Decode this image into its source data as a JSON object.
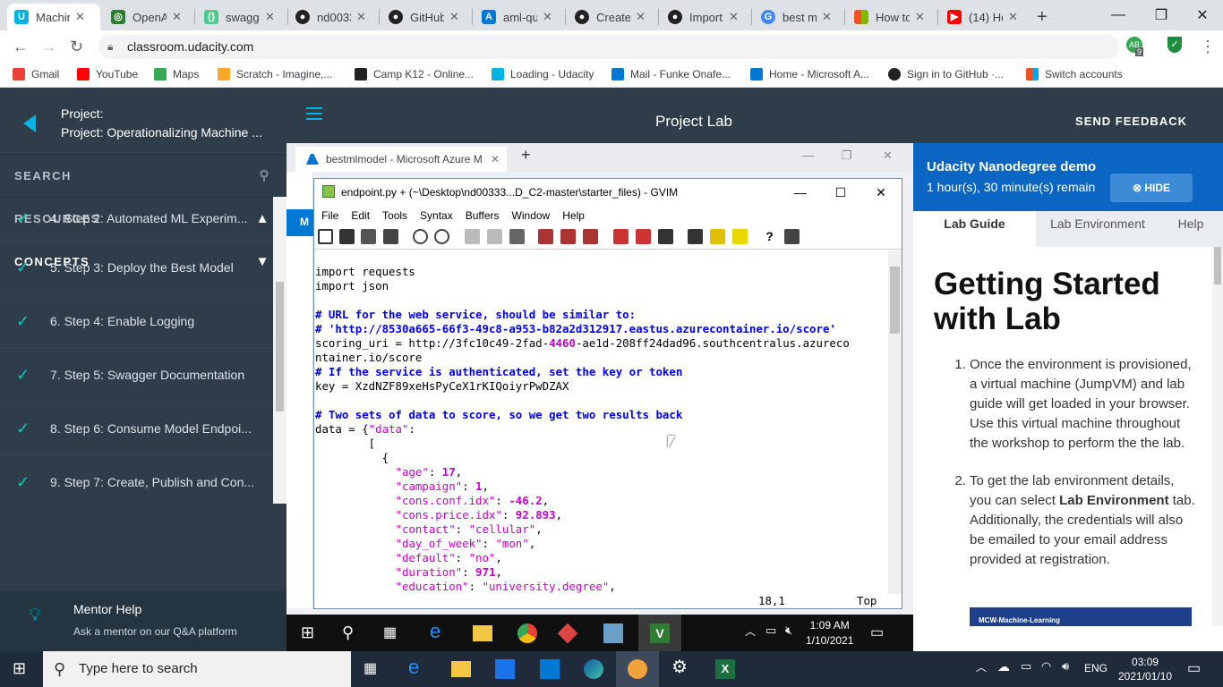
{
  "browser": {
    "tabs": [
      {
        "title": "Machin"
      },
      {
        "title": "OpenA"
      },
      {
        "title": "swagge"
      },
      {
        "title": "nd0033"
      },
      {
        "title": "GitHub"
      },
      {
        "title": "aml-qu"
      },
      {
        "title": "Create"
      },
      {
        "title": "Import"
      },
      {
        "title": "best m"
      },
      {
        "title": "How to"
      },
      {
        "title": "(14) Ho"
      }
    ],
    "url": "classroom.udacity.com",
    "profile_badge": "9",
    "bookmarks": [
      {
        "label": "Gmail",
        "color": "#ea4335"
      },
      {
        "label": "YouTube",
        "color": "#ff0000"
      },
      {
        "label": "Maps",
        "color": "#34a853"
      },
      {
        "label": "Scratch - Imagine,...",
        "color": "#f9a825"
      },
      {
        "label": "Camp K12 - Online...",
        "color": "#222222"
      },
      {
        "label": "Loading - Udacity",
        "color": "#02b3e4"
      },
      {
        "label": "Mail - Funke Onafe...",
        "color": "#0078d4"
      },
      {
        "label": "Home - Microsoft A...",
        "color": "#0078d4"
      },
      {
        "label": "Sign in to GitHub ·...",
        "color": "#222222"
      },
      {
        "label": "Switch accounts",
        "color": "#f25022"
      }
    ]
  },
  "udacity": {
    "project_label": "Project:",
    "project_title": "Project: Operationalizing Machine ...",
    "search_label": "SEARCH",
    "resources_label": "RESOURCES",
    "concepts_label": "CONCEPTS",
    "concepts": [
      "4. Step 2: Automated ML Experim...",
      "5. Step 3: Deploy the Best Model",
      "6. Step 4: Enable Logging",
      "7. Step 5: Swagger Documentation",
      "8. Step 6: Consume Model Endpoi...",
      "9. Step 7: Create, Publish and Con..."
    ],
    "mentor_title": "Mentor Help",
    "mentor_sub": "Ask a mentor on our Q&A platform",
    "header_title": "Project Lab",
    "feedback": "SEND FEEDBACK"
  },
  "vm": {
    "edge_tab": "bestmlmodel - Microsoft Azure M",
    "azure_letter": "M",
    "gvim": {
      "title": "endpoint.py + (~\\Desktop\\nd00333...D_C2-master\\starter_files) - GVIM",
      "menu": [
        "File",
        "Edit",
        "Tools",
        "Syntax",
        "Buffers",
        "Window",
        "Help"
      ],
      "status_pos": "18,1",
      "status_scroll": "Top"
    },
    "clock_time": "1:09 AM",
    "clock_date": "1/10/2021"
  },
  "lab": {
    "heading": "Udacity Nanodegree demo",
    "time_left": "1 hour(s), 30 minute(s) remain",
    "hide": "HIDE",
    "tabs": [
      "Lab Guide",
      "Lab Environment",
      "Help"
    ],
    "title": "Getting Started with Lab",
    "step1": "Once the environment is provisioned, a virtual machine (JumpVM) and lab guide will get loaded in your browser. Use this virtual machine throughout the workshop to perform the the lab.",
    "step2_a": "To get the lab environment details, you can select ",
    "step2_b": "Lab Environment",
    "step2_c": " tab. Additionally, the credentials will also be emailed to your email address provided at registration.",
    "banner": "MCW-Machine-Learning"
  },
  "windows": {
    "search_placeholder": "Type here to search",
    "lang": "ENG",
    "time": "03:09",
    "date": "2021/01/10"
  },
  "colors": {
    "udacity_dark": "#2e3d49",
    "udacity_blue": "#02b3e4",
    "check": "#02ccba",
    "azure_blue": "#0a66c2",
    "vim_comment": "#0000ff",
    "vim_string": "#cc00cc"
  }
}
